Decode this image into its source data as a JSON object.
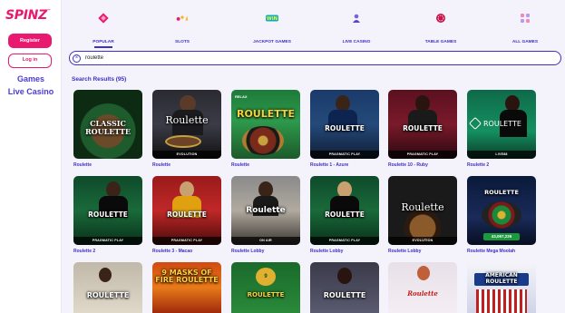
{
  "brand": {
    "logo": "SPINZ",
    "accent": "#e8196f",
    "primary": "#3d2fc8"
  },
  "sidebar": {
    "register_label": "Register",
    "login_label": "Log in",
    "links": [
      "Games",
      "Live Casino"
    ]
  },
  "categories": [
    {
      "label": "POPULAR",
      "icon": "diamond-icon",
      "active": true
    },
    {
      "label": "SLOTS",
      "icon": "fruits-icon",
      "active": false
    },
    {
      "label": "JACKPOT GAMES",
      "icon": "jackpot-icon",
      "active": false
    },
    {
      "label": "LIVE CASINO",
      "icon": "live-dealer-icon",
      "active": false
    },
    {
      "label": "TABLE GAMES",
      "icon": "chip-icon",
      "active": false
    },
    {
      "label": "ALL GAMES",
      "icon": "grid-icon",
      "active": false
    }
  ],
  "search": {
    "value": "roulette",
    "placeholder": ""
  },
  "results": {
    "title": "Search Results (95)"
  },
  "games": [
    {
      "name": "Roulette",
      "art_text": "CLASSIC ROULETTE",
      "provider": ""
    },
    {
      "name": "Roulette",
      "art_text": "Roulette",
      "provider": "EVOLUTION"
    },
    {
      "name": "Roulette",
      "art_text": "ROULETTE",
      "provider": ""
    },
    {
      "name": "Roulette 1 - Azure",
      "art_text": "ROULETTE",
      "provider": "PRAGMATIC PLAY"
    },
    {
      "name": "Roulette 10 - Ruby",
      "art_text": "ROULETTE",
      "provider": "PRAGMATIC PLAY"
    },
    {
      "name": "Roulette 2",
      "art_text": "ROULETTE",
      "provider": "LIVE88"
    },
    {
      "name": "Roulette 2",
      "art_text": "ROULETTE",
      "provider": "PRAGMATIC PLAY"
    },
    {
      "name": "Roulette 3 - Macao",
      "art_text": "ROULETTE",
      "provider": "PRAGMATIC PLAY"
    },
    {
      "name": "Roulette Lobby",
      "art_text": "Roulette",
      "provider": "ON AIR"
    },
    {
      "name": "Roulette Lobby",
      "art_text": "ROULETTE",
      "provider": "PRAGMATIC PLAY"
    },
    {
      "name": "Roulette Lobby",
      "art_text": "Roulette",
      "provider": "EVOLUTION"
    },
    {
      "name": "Roulette Mega Moolah",
      "art_text": "ROULETTE",
      "provider": ""
    },
    {
      "name": "",
      "art_text": "ROULETTE",
      "provider": ""
    },
    {
      "name": "",
      "art_text": "9 MASKS OF FIRE ROULETTE",
      "provider": ""
    },
    {
      "name": "",
      "art_text": "ROULETTE",
      "provider": ""
    },
    {
      "name": "",
      "art_text": "ROULETTE",
      "provider": ""
    },
    {
      "name": "",
      "art_text": "Roulette",
      "provider": ""
    },
    {
      "name": "",
      "art_text": "AMERICAN ROULETTE",
      "provider": ""
    }
  ],
  "jackpot_amount": "43,067,226"
}
